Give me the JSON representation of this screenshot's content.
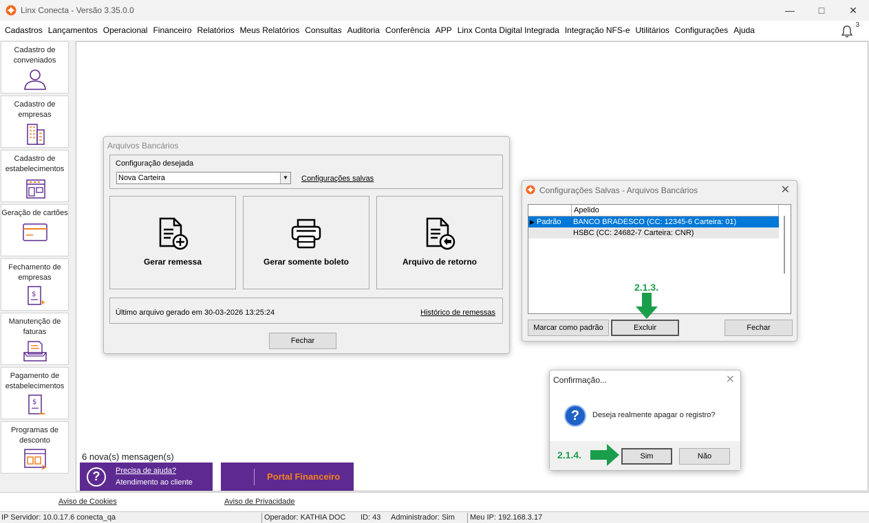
{
  "window": {
    "title": "Linx Conecta - Versão 3.35.0.0",
    "min_icon": "minimize-icon",
    "max_icon": "maximize-icon",
    "close_icon": "close-icon"
  },
  "menu": [
    "Cadastros",
    "Lançamentos",
    "Operacional",
    "Financeiro",
    "Relatórios",
    "Meus Relatórios",
    "Consultas",
    "Auditoria",
    "Conferência",
    "APP",
    "Linx Conta Digital Integrada",
    "Integração NFS-e",
    "Utilitários",
    "Configurações",
    "Ajuda"
  ],
  "notifications": {
    "count": "3"
  },
  "sidebar": [
    {
      "label": "Cadastro de conveniados",
      "icon": "person-icon"
    },
    {
      "label": "Cadastro de empresas",
      "icon": "building-icon"
    },
    {
      "label": "Cadastro de estabelecimentos",
      "icon": "store-icon"
    },
    {
      "label": "Geração de cartões",
      "icon": "card-icon"
    },
    {
      "label": "Fechamento de empresas",
      "icon": "invoice-close-icon"
    },
    {
      "label": "Manutenção de faturas",
      "icon": "invoice-tray-icon"
    },
    {
      "label": "Pagamento de estabelecimentos",
      "icon": "payment-icon"
    },
    {
      "label": "Programas de desconto",
      "icon": "discount-icon"
    }
  ],
  "messages": "6 nova(s) mensagen(s)",
  "help": {
    "line1": "Precisa de ajuda?",
    "line2": "Atendimento ao cliente"
  },
  "portal": {
    "label": "Portal Financeiro"
  },
  "footer": {
    "cookies": "Aviso de Cookies",
    "privacy": "Aviso de Privacidade"
  },
  "status": {
    "server": "IP Servidor: 10.0.17.6 conecta_qa",
    "operator": "Operador: KATHIA DOC",
    "id": "ID: 43",
    "admin": "Administrador: Sim",
    "my_ip": "Meu IP: 192.168.3.17"
  },
  "arquivos": {
    "title": "Arquivos Bancários",
    "config_label": "Configuração desejada",
    "config_value": "Nova Carteira",
    "config_link": "Configurações salvas",
    "tiles": [
      {
        "label": "Gerar remessa",
        "icon": "document-add-icon"
      },
      {
        "label": "Gerar somente boleto",
        "icon": "printer-icon"
      },
      {
        "label": "Arquivo de retorno",
        "icon": "document-return-icon"
      }
    ],
    "last_file": "Último arquivo gerado em 30-03-2026 13:25:24",
    "history_link": "Histórico de remessas",
    "close": "Fechar"
  },
  "salvas": {
    "title": "Configurações Salvas - Arquivos Bancários",
    "col_header": "Apelido",
    "rows": [
      {
        "flag": "Padrão",
        "name": "BANCO BRADESCO (CC: 12345-6 Carteira: 01)"
      },
      {
        "flag": "",
        "name": "HSBC (CC: 24682-7 Carteira: CNR)"
      }
    ],
    "btn_default": "Marcar como padrão",
    "btn_delete": "Excluir",
    "btn_close": "Fechar",
    "annotation": "2.1.3."
  },
  "confirm": {
    "title": "Confirmação...",
    "message": "Deseja realmente apagar o registro?",
    "yes": "Sim",
    "no": "Não",
    "annotation": "2.1.4."
  },
  "colors": {
    "purple": "#5d2a91",
    "orange": "#f3811f",
    "selection": "#0078d7",
    "annotation_green": "#1b9e4b"
  }
}
